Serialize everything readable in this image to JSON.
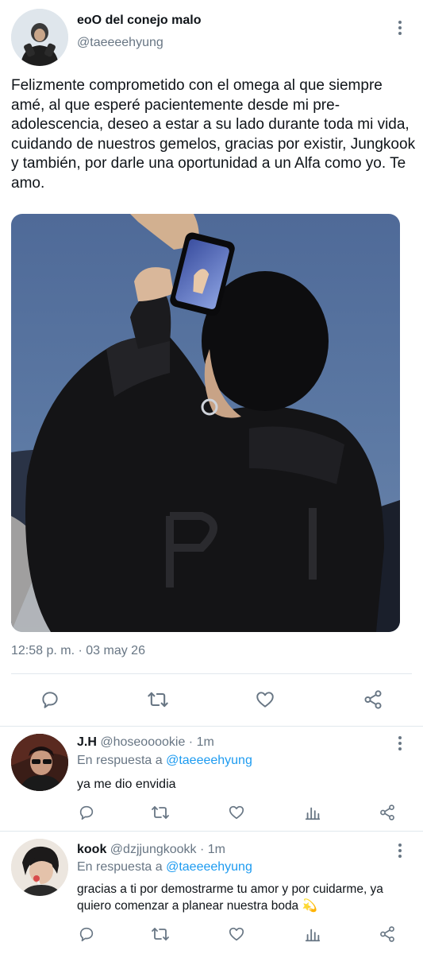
{
  "main_tweet": {
    "display_name": "eoO del conejo malo",
    "handle": "@taeeeehyung",
    "text": "Felizmente comprometido con el omega al que siempre amé, al que esperé pacientemente desde mi pre-adolescencia, deseo a estar a su lado durante toda mi vida, cuidando de nuestros gemelos, gracias por existir, Jungkook y también, por darle una oportunidad a un Alfa como yo. Te amo.",
    "timestamp": "12:58 p. m. · 03 may 26",
    "actions": [
      "reply-icon",
      "retweet-icon",
      "like-icon",
      "share-icon"
    ]
  },
  "replies": [
    {
      "display_name": "J.H",
      "handle_time": "@hoseooookie · 1m",
      "reply_prefix": "En respuesta a",
      "reply_mention": "@taeeeehyung",
      "text": "ya me dio envidia",
      "actions": [
        "reply-icon",
        "retweet-icon",
        "like-icon",
        "analytics-icon",
        "share-icon"
      ]
    },
    {
      "display_name": "kook",
      "handle_time": "@dzjjungkookk · 1m",
      "reply_prefix": "En respuesta a",
      "reply_mention": "@taeeeehyung",
      "text": "gracias a ti por demostrarme tu amor y por cuidarme, ya quiero comenzar a planear nuestra boda 💫",
      "actions": [
        "reply-icon",
        "retweet-icon",
        "like-icon",
        "analytics-icon",
        "share-icon"
      ]
    }
  ],
  "colors": {
    "text_primary": "#0f1419",
    "text_secondary": "#687684",
    "accent": "#1d9bf0",
    "divider": "#e1e8ed"
  }
}
